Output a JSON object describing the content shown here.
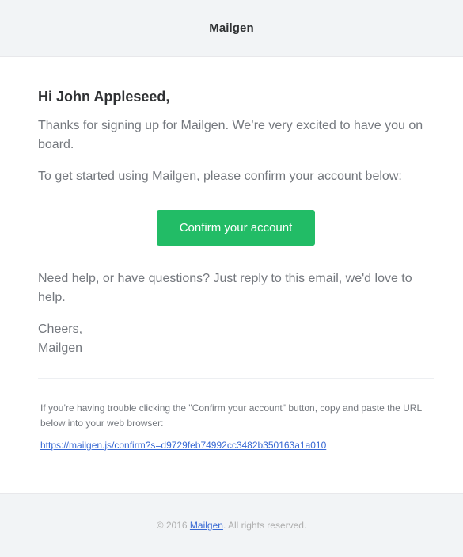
{
  "header": {
    "brand": "Mailgen"
  },
  "body": {
    "greeting": "Hi John Appleseed,",
    "intro": "Thanks for signing up for Mailgen. We’re very excited to have you on board.",
    "instructions": "To get started using Mailgen, please confirm your account below:",
    "button_label": "Confirm your account",
    "outro": "Need help, or have questions? Just reply to this email, we'd love to help.",
    "signoff_1": "Cheers,",
    "signoff_2": "Mailgen"
  },
  "subcopy": {
    "trouble": "If you’re having trouble clicking the \"Confirm your account\" button, copy and paste the URL below into your web browser:",
    "link": "https://mailgen.js/confirm?s=d9729feb74992cc3482b350163a1a010"
  },
  "footer": {
    "copyright_prefix": "© 2016 ",
    "brand_link": "Mailgen",
    "copyright_suffix": ". All rights reserved."
  },
  "colors": {
    "accent": "#22bc66",
    "link": "#3869d4",
    "text": "#74787e",
    "heading": "#2f3133",
    "band": "#f2f4f6"
  }
}
